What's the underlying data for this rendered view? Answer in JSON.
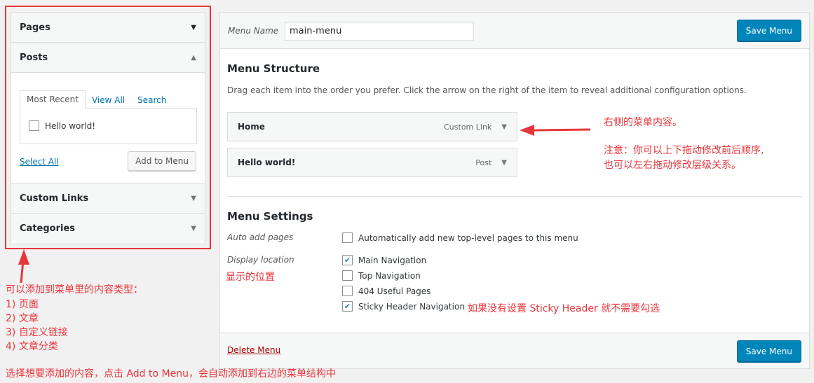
{
  "left_panel": {
    "sections": {
      "pages": "Pages",
      "posts": "Posts",
      "custom_links": "Custom Links",
      "categories": "Categories"
    },
    "posts_tabs": [
      "Most Recent",
      "View All",
      "Search"
    ],
    "posts_items": [
      {
        "label": "Hello world!",
        "checked": false
      }
    ],
    "select_all": "Select All",
    "add_to_menu": "Add to Menu"
  },
  "right_panel": {
    "menu_name_label": "Menu Name",
    "menu_name_value": "main-menu",
    "save_menu": "Save Menu",
    "structure_title": "Menu Structure",
    "structure_desc": "Drag each item into the order you prefer. Click the arrow on the right of the item to reveal additional configuration options.",
    "menu_items": [
      {
        "title": "Home",
        "type": "Custom Link"
      },
      {
        "title": "Hello world!",
        "type": "Post"
      }
    ],
    "settings_title": "Menu Settings",
    "auto_add_label": "Auto add pages",
    "auto_add_option": {
      "label": "Automatically add new top-level pages to this menu",
      "checked": false
    },
    "display_location_label": "Display location",
    "locations": [
      {
        "label": "Main Navigation",
        "checked": true
      },
      {
        "label": "Top Navigation",
        "checked": false
      },
      {
        "label": "404 Useful Pages",
        "checked": false
      },
      {
        "label": "Sticky Header Navigation",
        "checked": true
      }
    ],
    "delete_menu": "Delete Menu"
  },
  "annotations": {
    "menu_content": "右侧的菜单内容。",
    "note_line1": "注意：你可以上下拖动修改前后顺序,",
    "note_line2": "也可以左右拖动修改层级关系。",
    "display_position": "显示的位置",
    "sticky_note": "如果没有设置 Sticky Header 就不需要勾选",
    "content_types_title": "可以添加到菜单里的内容类型：",
    "content_types": [
      "1) 页面",
      "2) 文章",
      "3) 自定义链接",
      "4) 文章分类"
    ],
    "bottom_instruction": "选择想要添加的内容，点击 Add to Menu，会自动添加到右边的菜单结构中"
  },
  "colors": {
    "annotation": "#e8353b",
    "primary_button": "#0085ba",
    "link": "#0073aa",
    "delete": "#a00"
  }
}
